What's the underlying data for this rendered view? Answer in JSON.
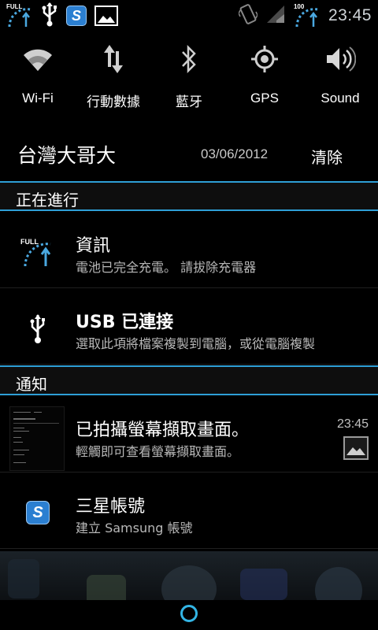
{
  "status_bar": {
    "battery_label": "FULL",
    "battery_label_right": "100",
    "time": "23:45"
  },
  "quick_settings": [
    {
      "label": "Wi-Fi",
      "icon": "wifi-icon"
    },
    {
      "label": "行動數據",
      "icon": "mobile-data-icon"
    },
    {
      "label": "藍牙",
      "icon": "bluetooth-icon"
    },
    {
      "label": "GPS",
      "icon": "gps-icon"
    },
    {
      "label": "Sound",
      "icon": "sound-icon"
    }
  ],
  "header": {
    "carrier": "台灣大哥大",
    "date": "03/06/2012",
    "clear_label": "清除"
  },
  "ongoing": {
    "title": "正在進行",
    "items": [
      {
        "title": "資訊",
        "text": "電池已完全充電。 請拔除充電器",
        "icon": "battery-full-icon",
        "icon_label": "FULL"
      },
      {
        "title": "USB 已連接",
        "text": "選取此項將檔案複製到電腦，或從電腦複製",
        "icon": "usb-icon"
      }
    ]
  },
  "notifications": {
    "title": "通知",
    "items": [
      {
        "title": "已拍攝螢幕擷取畫面。",
        "text": "輕觸即可查看螢幕擷取畫面。",
        "time": "23:45",
        "icon": "screenshot-thumbnail"
      },
      {
        "title": "三星帳號",
        "text": "建立 Samsung 帳號",
        "icon": "samsung-account-icon"
      }
    ]
  },
  "colors": {
    "accent": "#33b5e5",
    "divider": "#2e9fd6"
  }
}
